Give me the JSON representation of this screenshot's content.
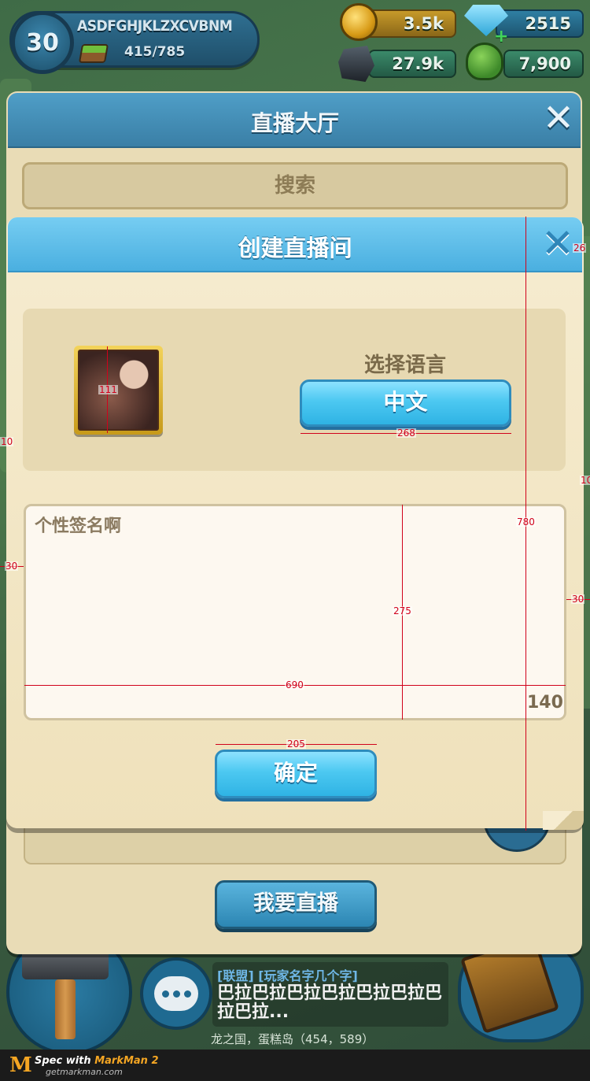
{
  "hud": {
    "level": "30",
    "player_name": "ASDFGHJKLZXCVBNM",
    "xp": "415/785",
    "gold": "3.5k",
    "gems": "2515",
    "stone": "27.9k",
    "wood": "7,900",
    "icons": {
      "gold": "coin-icon",
      "gems": "gem-icon",
      "stone": "stone-icon",
      "wood": "tree-icon"
    }
  },
  "hall": {
    "title": "直播大厅",
    "search_placeholder": "搜索",
    "go_live_label": "我要直播"
  },
  "dialog": {
    "title": "创建直播间",
    "language_label": "选择语言",
    "language_value": "中文",
    "signature_placeholder": "个性签名啊",
    "char_count": "140",
    "confirm_label": "确定"
  },
  "chat": {
    "tag": "[联盟] [玩家名字几个字]",
    "message": "巴拉巴拉巴拉巴拉巴拉巴拉巴拉巴拉...",
    "location": "龙之国，蛋糕岛（454，589）"
  },
  "markman": {
    "line1_prefix": "Spec with ",
    "line1_brand": "MarkMan 2",
    "url": "getmarkman.com",
    "measurements": {
      "avatar_size": "111",
      "lang_button_width": "268",
      "dialog_height": "780",
      "signature_height": "275",
      "signature_width": "690",
      "confirm_width": "205",
      "left_margin": "30",
      "right_margin": "30",
      "close_offset": "26",
      "left_edge": "10",
      "right_edge": "10"
    }
  },
  "colors": {
    "accent_blue": "#4cc8f1",
    "header_blue": "#4aafe0",
    "parchment": "#f6ecd0",
    "markman_red": "#d0021b"
  }
}
